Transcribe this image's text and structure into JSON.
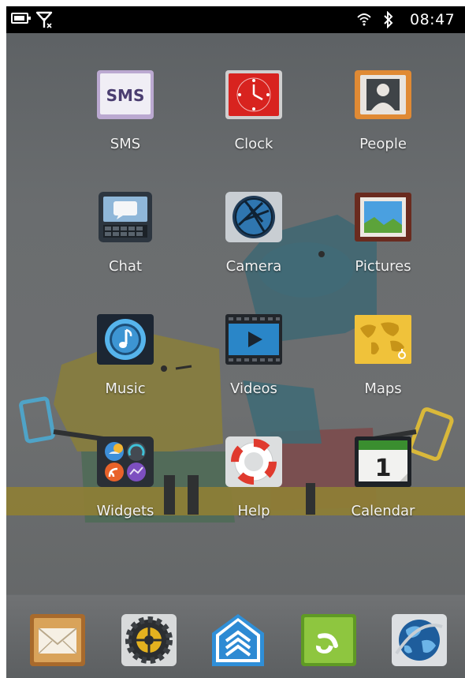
{
  "status_bar": {
    "time": "08:47",
    "icons": [
      "battery-icon",
      "no-sim-signal-icon",
      "wifi-icon",
      "bluetooth-icon"
    ]
  },
  "apps": [
    {
      "label": "SMS",
      "icon": "sms-icon",
      "icon_text": "SMS"
    },
    {
      "label": "Clock",
      "icon": "clock-icon"
    },
    {
      "label": "People",
      "icon": "people-icon"
    },
    {
      "label": "Chat",
      "icon": "chat-icon"
    },
    {
      "label": "Camera",
      "icon": "camera-icon"
    },
    {
      "label": "Pictures",
      "icon": "pictures-icon"
    },
    {
      "label": "Music",
      "icon": "music-icon"
    },
    {
      "label": "Videos",
      "icon": "videos-icon"
    },
    {
      "label": "Maps",
      "icon": "maps-icon"
    },
    {
      "label": "Widgets",
      "icon": "widgets-icon"
    },
    {
      "label": "Help",
      "icon": "help-lifebuoy-icon"
    },
    {
      "label": "Calendar",
      "icon": "calendar-icon",
      "icon_text": "1"
    }
  ],
  "dock": [
    "email-icon",
    "settings-gear-icon",
    "app-launcher-chevron-icon",
    "phone-icon",
    "browser-globe-icon"
  ],
  "colors": {
    "status_bar": "#000000",
    "label": "#f2f2f2",
    "launcher_accent": "#2f8fd8",
    "phone_green": "#7cbf2e"
  }
}
